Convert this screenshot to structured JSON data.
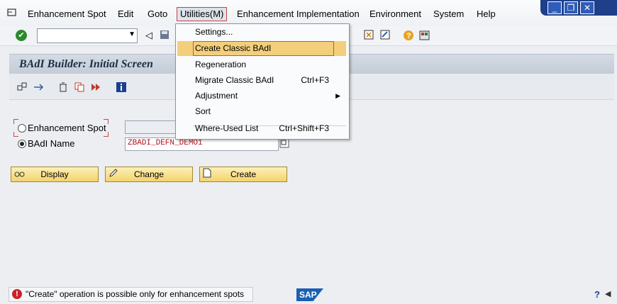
{
  "menubar": {
    "items": [
      "Enhancement Spot",
      "Edit",
      "Goto",
      "Utilities(M)",
      "Enhancement Implementation",
      "Environment",
      "System",
      "Help"
    ],
    "active_index": 3
  },
  "window_controls": {
    "minimize": "_",
    "restore": "❐",
    "close": "✕"
  },
  "toolbar": {
    "command_field": "",
    "ok_icon": "✔"
  },
  "title": "BAdI Builder: Initial Screen",
  "form": {
    "enh_spot_label": "Enhancement Spot",
    "badi_label": "BAdI Name",
    "badi_value": "ZBADI_DEFN_DEMO1",
    "selected": "badi"
  },
  "buttons": {
    "display": "Display",
    "change": "Change",
    "create": "Create"
  },
  "dropdown": {
    "items": [
      {
        "label": "Settings...",
        "shortcut": "",
        "submenu": false
      },
      {
        "label": "Create Classic BAdI",
        "shortcut": "",
        "submenu": false,
        "highlighted": true
      },
      {
        "label": "Regeneration",
        "shortcut": "",
        "submenu": false
      },
      {
        "label": "Migrate Classic BAdI",
        "shortcut": "Ctrl+F3",
        "submenu": false
      },
      {
        "label": "Adjustment",
        "shortcut": "",
        "submenu": true
      },
      {
        "label": "Sort",
        "shortcut": "",
        "submenu": false
      },
      {
        "label": "Where-Used List",
        "shortcut": "Ctrl+Shift+F3",
        "submenu": false
      }
    ]
  },
  "status": {
    "message": "\"Create\" operation is possible only for enhancement spots",
    "logo": "SAP"
  },
  "colors": {
    "accent_button": "#f3d36c",
    "menu_highlight": "#f3cf7b",
    "error": "#cc2128",
    "value_text": "#b0131a"
  }
}
